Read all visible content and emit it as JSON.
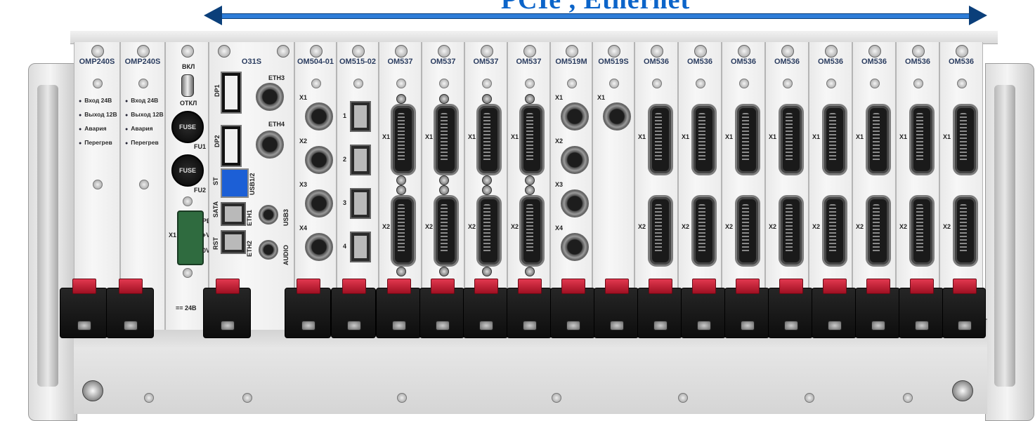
{
  "header": {
    "title": "PCIe , Ethernet",
    "arrow_color": "#2e7dd8"
  },
  "modules": [
    {
      "label": "OMP240S",
      "leds": [
        "Вход 24В",
        "Выход 12В",
        "Авария",
        "Перегрев"
      ]
    },
    {
      "label": "OMP240S",
      "leds": [
        "Вход 24В",
        "Выход 12В",
        "Авария",
        "Перегрев"
      ]
    },
    {
      "label": "",
      "switch_on": "ВКЛ",
      "switch_off": "ОТКЛ",
      "fuse_text": "FUSE",
      "fu1": "FU1",
      "fu2": "FU2",
      "x1": "X1",
      "pe": "PE",
      "plus_v": "+V",
      "zero_v": "0V",
      "supply": "== 24В"
    },
    {
      "label": "O31S",
      "dp1": "DP1",
      "dp2": "DP2",
      "eth3": "ETH3",
      "eth4": "ETH4",
      "usb12": "USB1/2",
      "usb3": "USB3",
      "st": "ST",
      "sata": "SATA",
      "rst": "RST",
      "eth1": "ETH1",
      "eth2": "ETH2",
      "audio": "AUDIO"
    },
    {
      "label": "OM504-01",
      "ports": [
        "X1",
        "X2",
        "X3",
        "X4"
      ]
    },
    {
      "label": "OM515-02",
      "rj_labels": [
        "1",
        "2",
        "3",
        "4"
      ]
    },
    {
      "label": "OM537",
      "ports": [
        "X1",
        "X2"
      ]
    },
    {
      "label": "OM537",
      "ports": [
        "X1",
        "X2"
      ]
    },
    {
      "label": "OM537",
      "ports": [
        "X1",
        "X2"
      ]
    },
    {
      "label": "OM537",
      "ports": [
        "X1",
        "X2"
      ]
    },
    {
      "label": "OM519M",
      "ports": [
        "X1",
        "X2",
        "X3",
        "X4"
      ]
    },
    {
      "label": "OM519S",
      "ports": [
        "X1"
      ]
    },
    {
      "label": "OM536",
      "ports": [
        "X1",
        "X2"
      ]
    },
    {
      "label": "OM536",
      "ports": [
        "X1",
        "X2"
      ]
    },
    {
      "label": "OM536",
      "ports": [
        "X1",
        "X2"
      ]
    },
    {
      "label": "OM536",
      "ports": [
        "X1",
        "X2"
      ]
    },
    {
      "label": "OM536",
      "ports": [
        "X1",
        "X2"
      ]
    },
    {
      "label": "OM536",
      "ports": [
        "X1",
        "X2"
      ]
    },
    {
      "label": "OM536",
      "ports": [
        "X1",
        "X2"
      ]
    },
    {
      "label": "OM536",
      "ports": [
        "X1",
        "X2"
      ]
    }
  ]
}
